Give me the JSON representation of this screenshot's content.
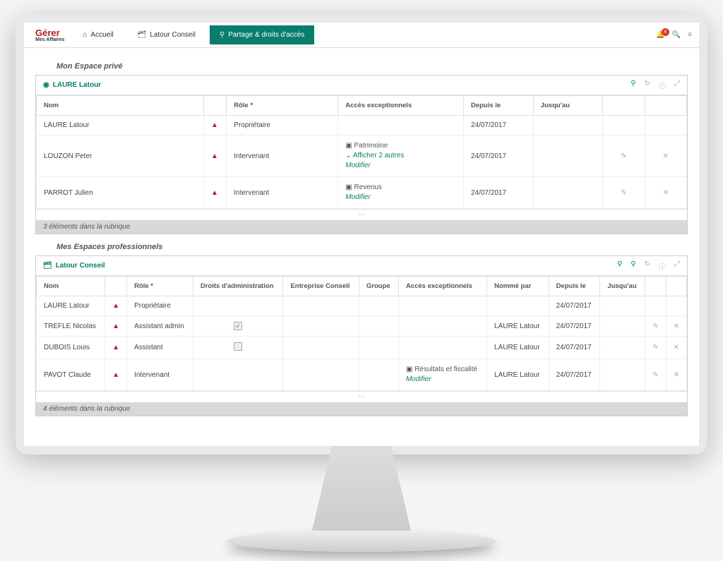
{
  "logo": {
    "main": "Gérer",
    "sub": "Mes Affaires"
  },
  "nav": {
    "home": "Accueil",
    "company": "Latour Conseil",
    "sharing": "Partage & droits d'accès"
  },
  "notifications": {
    "count": "4"
  },
  "section_private": "Mon Espace privé",
  "section_pro": "Mes Espaces professionnels",
  "panel1": {
    "title": "LAURE Latour",
    "headers": {
      "nom": "Nom",
      "role": "Rôle *",
      "access": "Accès exceptionnels",
      "depuis": "Depuis le",
      "jusqua": "Jusqu'au"
    },
    "rows": [
      {
        "nom": "LAURE Latour",
        "role": "Propriétaire",
        "accessFolder": "",
        "accessMore": "",
        "accessMod": "",
        "depuis": "24/07/2017",
        "editable": false
      },
      {
        "nom": "LOUZON Peter",
        "role": "Intervenant",
        "accessFolder": "Patrimoine",
        "accessMore": "Afficher 2 autres",
        "accessMod": "Modifier",
        "depuis": "24/07/2017",
        "editable": true
      },
      {
        "nom": "PARROT Julien",
        "role": "Intervenant",
        "accessFolder": "Revenus",
        "accessMore": "",
        "accessMod": "Modifier",
        "depuis": "24/07/2017",
        "editable": true
      }
    ],
    "summary": "3 éléments dans la rubrique"
  },
  "panel2": {
    "title": "Latour Conseil",
    "headers": {
      "nom": "Nom",
      "role": "Rôle *",
      "droits": "Droits d'administration",
      "entreprise": "Entreprise Conseil",
      "groupe": "Groupe",
      "access": "Accès exceptionnels",
      "nomme": "Nommé par",
      "depuis": "Depuis le",
      "jusqua": "Jusqu'au"
    },
    "rows": [
      {
        "nom": "LAURE Latour",
        "role": "Propriétaire",
        "admin": "",
        "nomme": "",
        "depuis": "24/07/2017",
        "accessFolder": "",
        "accessMod": "",
        "editable": false
      },
      {
        "nom": "TREFLE Nicolas",
        "role": "Assistant admin",
        "admin": "checked",
        "nomme": "LAURE Latour",
        "depuis": "24/07/2017",
        "accessFolder": "",
        "accessMod": "",
        "editable": true
      },
      {
        "nom": "DUBOIS Louis",
        "role": "Assistant",
        "admin": "unchecked",
        "nomme": "LAURE Latour",
        "depuis": "24/07/2017",
        "accessFolder": "",
        "accessMod": "",
        "editable": true
      },
      {
        "nom": "PAVOT Claude",
        "role": "Intervenant",
        "admin": "",
        "nomme": "LAURE Latour",
        "depuis": "24/07/2017",
        "accessFolder": "Résultats et fiscalité",
        "accessMod": "Modifier",
        "editable": true
      }
    ],
    "summary": "4 éléments dans la rubrique"
  }
}
